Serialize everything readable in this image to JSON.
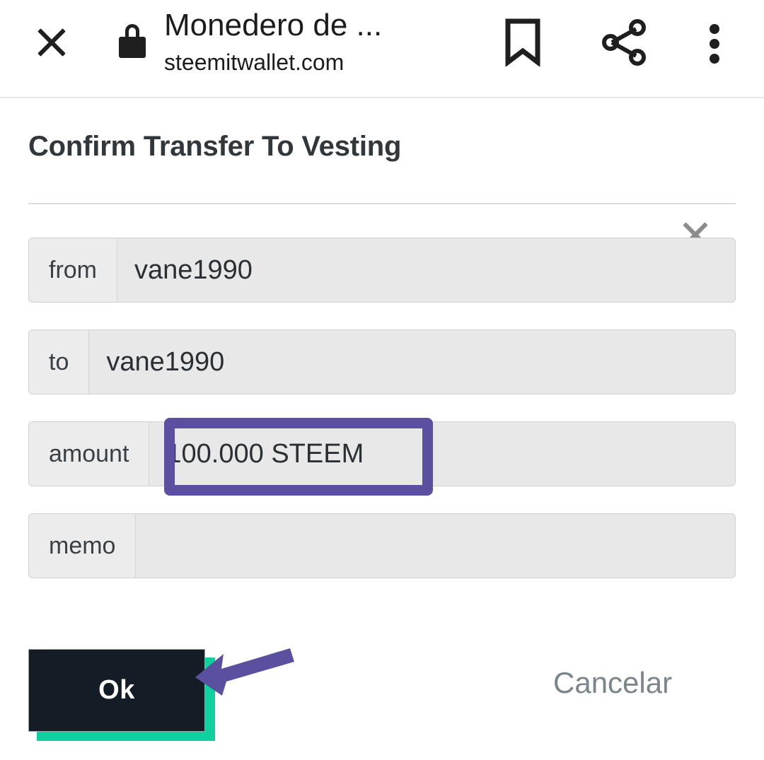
{
  "browser_bar": {
    "close_icon": "close-icon",
    "security_icon": "lock-icon",
    "page_title": "Monedero de ...",
    "page_url": "steemitwallet.com",
    "bookmark_icon": "bookmark-icon",
    "share_icon": "share-icon",
    "more_icon": "more-vertical-icon"
  },
  "dialog": {
    "title": "Confirm Transfer To Vesting",
    "close_icon": "close-icon",
    "rows": [
      {
        "label": "from",
        "value": "vane1990"
      },
      {
        "label": "to",
        "value": "vane1990"
      },
      {
        "label": "amount",
        "value": "100.000 STEEM"
      },
      {
        "label": "memo",
        "value": ""
      }
    ],
    "ok_label": "Ok",
    "cancel_label": "Cancelar"
  },
  "annotations": {
    "highlight_color": "#5b4fa0",
    "arrow_color": "#5b4fa0",
    "highlight_target": "amount-value",
    "arrow_target": "ok-button"
  },
  "colors": {
    "ok_button_bg": "#141c26",
    "ok_button_shadow": "#10d0a0",
    "field_bg": "#e8e8e8",
    "cancel_text": "#7b858c"
  }
}
